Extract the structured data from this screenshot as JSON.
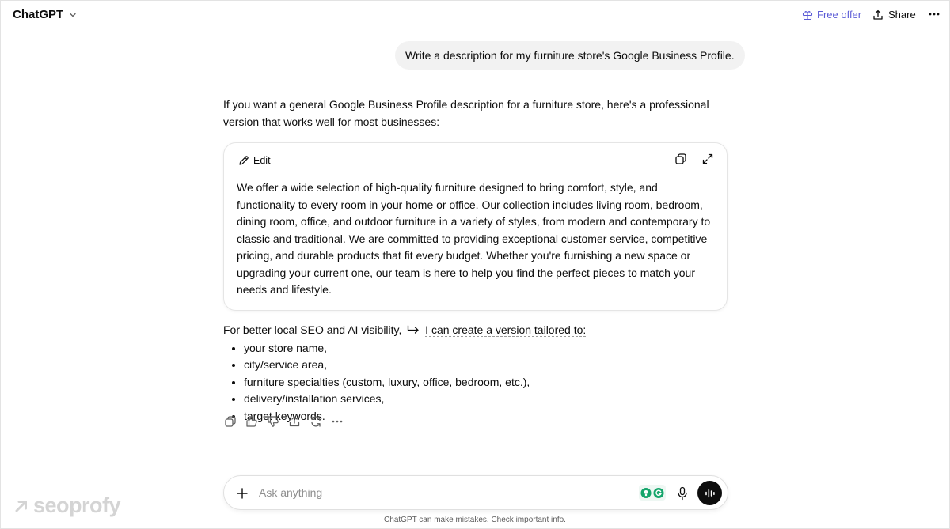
{
  "header": {
    "model_name": "ChatGPT",
    "free_offer_label": "Free offer",
    "share_label": "Share"
  },
  "user_message": "Write a description for my furniture store's Google Business Profile.",
  "assistant": {
    "intro": "If you want a general Google Business Profile description for a furniture store, here's a professional version that works well for most businesses:",
    "card": {
      "edit_label": "Edit",
      "body": "We offer a wide selection of high-quality furniture designed to bring comfort, style, and functionality to every room in your home or office. Our collection includes living room, bedroom, dining room, office, and outdoor furniture in a variety of styles, from modern and contemporary to classic and traditional. We are committed to providing exceptional customer service, competitive pricing, and durable products that fit every budget. Whether you're furnishing a new space or upgrading your current one, our team is here to help you find the perfect pieces to match your needs and lifestyle."
    },
    "follow_prefix": "For better local SEO and AI visibility,",
    "follow_link": "I can create a version tailored to:",
    "bullets": [
      "your store name,",
      "city/service area,",
      "furniture specialties (custom, luxury, office, bedroom, etc.),",
      "delivery/installation services,",
      "target keywords."
    ]
  },
  "composer": {
    "placeholder": "Ask anything"
  },
  "disclaimer": "ChatGPT can make mistakes. Check important info.",
  "watermark": "seoprofy",
  "colors": {
    "accent": "#5b5bd6",
    "bubble": "#f2f2f2",
    "voice_button": "#0d0d0d"
  }
}
